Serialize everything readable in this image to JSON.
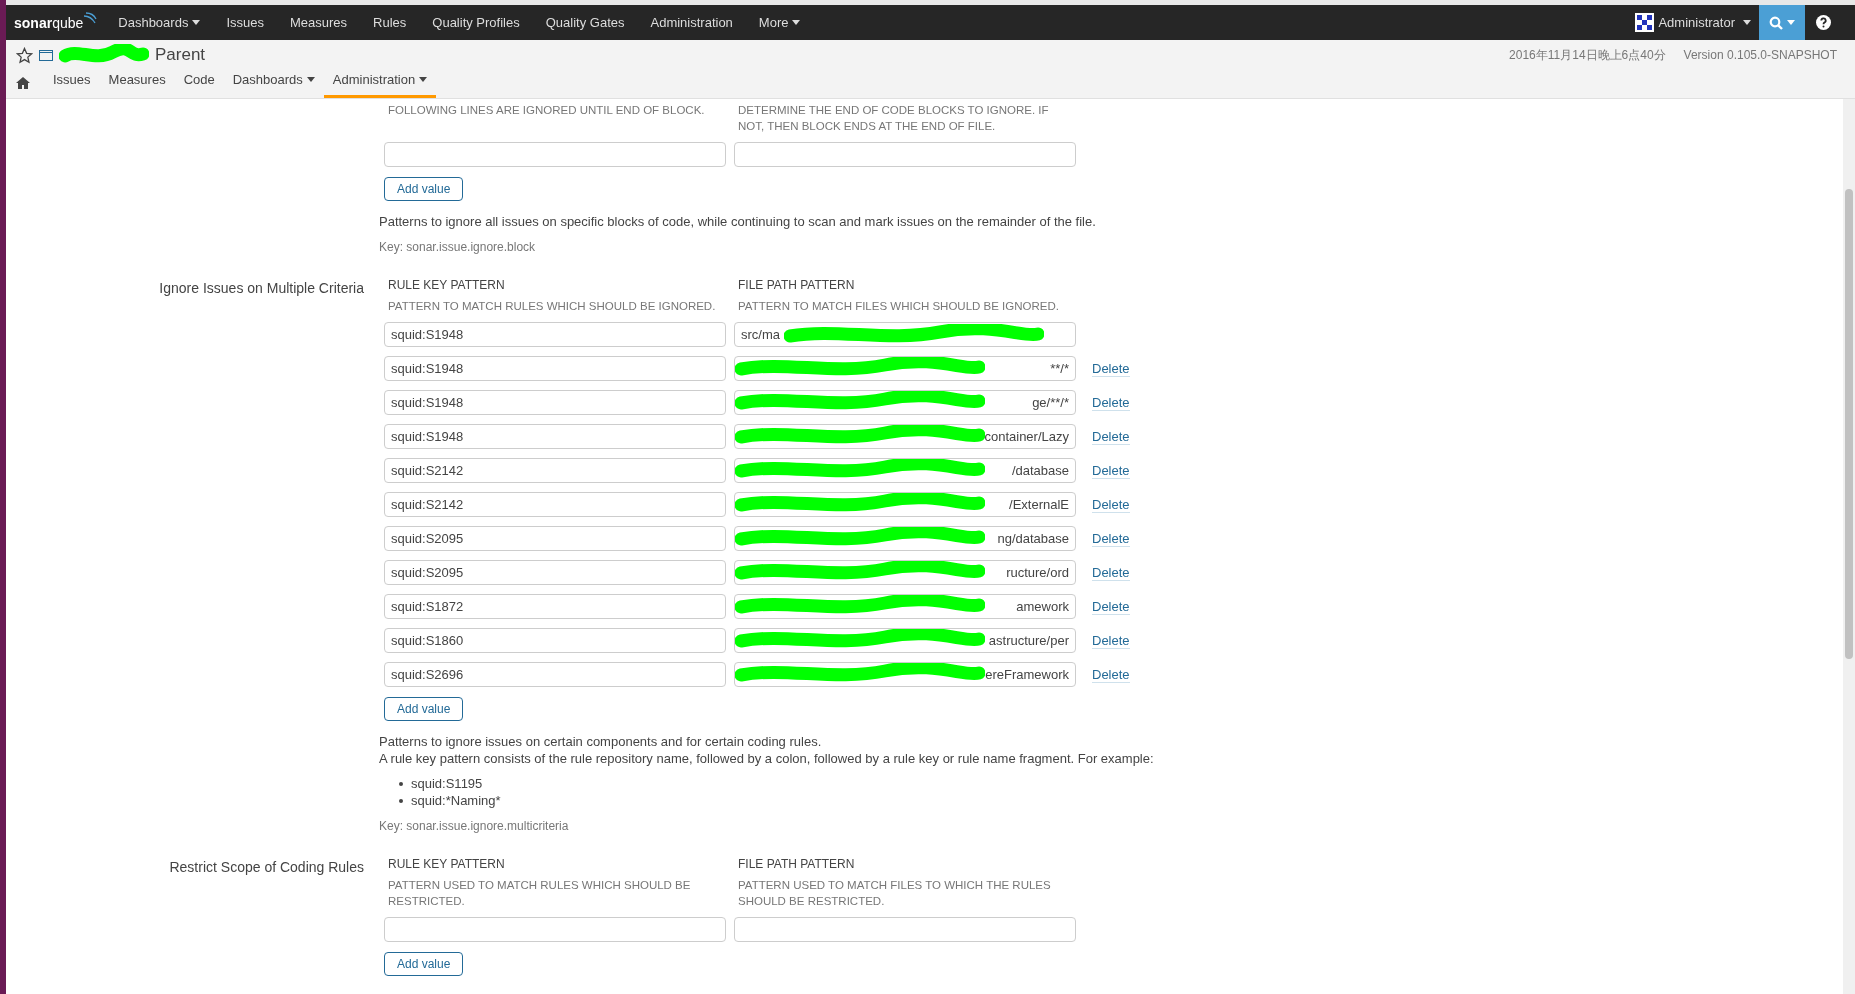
{
  "top_nav": {
    "logo": {
      "first": "sonar",
      "second": "qube"
    },
    "items": [
      {
        "label": "Dashboards",
        "dropdown": true
      },
      {
        "label": "Issues",
        "dropdown": false
      },
      {
        "label": "Measures",
        "dropdown": false
      },
      {
        "label": "Rules",
        "dropdown": false
      },
      {
        "label": "Quality Profiles",
        "dropdown": false
      },
      {
        "label": "Quality Gates",
        "dropdown": false
      },
      {
        "label": "Administration",
        "dropdown": false
      },
      {
        "label": "More",
        "dropdown": true
      }
    ],
    "user": "Administrator"
  },
  "project": {
    "title": "Parent",
    "date": "2016年11月14日晚上6点40分",
    "version": "Version 0.105.0-SNAPSHOT",
    "tabs": [
      {
        "label": "Issues",
        "selected": false,
        "dropdown": false
      },
      {
        "label": "Measures",
        "selected": false,
        "dropdown": false
      },
      {
        "label": "Code",
        "selected": false,
        "dropdown": false
      },
      {
        "label": "Dashboards",
        "selected": false,
        "dropdown": true
      },
      {
        "label": "Administration",
        "selected": true,
        "dropdown": true
      }
    ]
  },
  "sections": [
    {
      "columns": [
        {
          "description": "FOLLOWING LINES ARE IGNORED UNTIL END OF BLOCK."
        },
        {
          "description": "DETERMINE THE END OF CODE BLOCKS TO IGNORE. IF NOT, THEN BLOCK ENDS AT THE END OF FILE."
        }
      ],
      "rows": [
        {}
      ],
      "add_button": "Add value",
      "description": [
        "Patterns to ignore all issues on specific blocks of code, while continuing to scan and mark issues on the remainder of the file."
      ],
      "key": "Key: sonar.issue.ignore.block"
    },
    {
      "label": "Ignore Issues on Multiple Criteria",
      "columns": [
        {
          "header": "RULE KEY PATTERN",
          "description": "PATTERN TO MATCH RULES WHICH SHOULD BE IGNORED."
        },
        {
          "header": "FILE PATH PATTERN",
          "description": "PATTERN TO MATCH FILES WHICH SHOULD BE IGNORED."
        }
      ],
      "rows": [
        {
          "rule_key": "squid:S1948",
          "file_path": {
            "visible_start": "src/ma"
          }
        },
        {
          "rule_key": "squid:S1948",
          "file_path": {
            "visible_end": "**/*"
          },
          "delete": "Delete"
        },
        {
          "rule_key": "squid:S1948",
          "file_path": {
            "visible_end": "ge/**/*"
          },
          "delete": "Delete"
        },
        {
          "rule_key": "squid:S1948",
          "file_path": {
            "visible_end": "container/Lazy"
          },
          "delete": "Delete"
        },
        {
          "rule_key": "squid:S2142",
          "file_path": {
            "visible_end": "/database"
          },
          "delete": "Delete"
        },
        {
          "rule_key": "squid:S2142",
          "file_path": {
            "visible_end": "/ExternalE"
          },
          "delete": "Delete"
        },
        {
          "rule_key": "squid:S2095",
          "file_path": {
            "visible_end": "ng/database"
          },
          "delete": "Delete"
        },
        {
          "rule_key": "squid:S2095",
          "file_path": {
            "visible_end": "ructure/ord"
          },
          "delete": "Delete"
        },
        {
          "rule_key": "squid:S1872",
          "file_path": {
            "visible_end": "amework"
          },
          "delete": "Delete"
        },
        {
          "rule_key": "squid:S1860",
          "file_path": {
            "visible_end": "astructure/per"
          },
          "delete": "Delete"
        },
        {
          "rule_key": "squid:S2696",
          "file_path": {
            "visible_end": "ereFramework"
          },
          "delete": "Delete"
        }
      ],
      "add_button": "Add value",
      "description": [
        "Patterns to ignore issues on certain components and for certain coding rules.",
        "A rule key pattern consists of the rule repository name, followed by a colon, followed by a rule key or rule name fragment. For example:"
      ],
      "examples": [
        "squid:S1195",
        "squid:*Naming*"
      ],
      "key": "Key: sonar.issue.ignore.multicriteria"
    },
    {
      "label": "Restrict Scope of Coding Rules",
      "columns": [
        {
          "header": "RULE KEY PATTERN",
          "description": "PATTERN USED TO MATCH RULES WHICH SHOULD BE RESTRICTED."
        },
        {
          "header": "FILE PATH PATTERN",
          "description": "PATTERN USED TO MATCH FILES TO WHICH THE RULES SHOULD BE RESTRICTED."
        }
      ],
      "rows": [
        {}
      ],
      "add_button": "Add value"
    }
  ]
}
